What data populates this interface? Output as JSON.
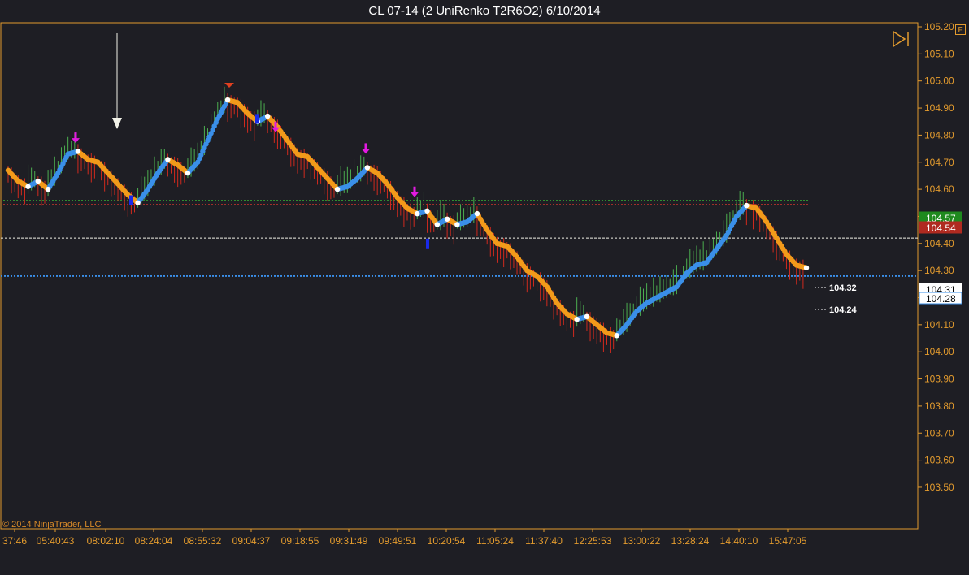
{
  "window": {
    "title": "CL 07-14 (2 UniRenko T2R6O2)  6/10/2014",
    "copyright": "© 2014 NinjaTrader, LLC",
    "corner_label": "F"
  },
  "colors": {
    "background": "#1e1e24",
    "axis": "#e39b2e",
    "text": "#e39b2e",
    "up_bar": "#4caf50",
    "down_bar": "#d12a1e",
    "trend_up": "#3a8fe8",
    "trend_down": "#f29a1a",
    "marker_pink": "#e21ae0",
    "marker_blue": "#1a2ae8"
  },
  "icons": [
    "play-to-end-icon",
    "down-arrow-icon"
  ],
  "chart_data": {
    "type": "line",
    "title": "CL 07-14 (2 UniRenko T2R6O2)  6/10/2014",
    "xlabel": "",
    "ylabel": "",
    "ylim": [
      103.42,
      105.3
    ],
    "y_ticks": [
      "105.20",
      "105.10",
      "105.00",
      "104.90",
      "104.80",
      "104.70",
      "104.60",
      "104.50",
      "104.40",
      "104.30",
      "104.20",
      "104.10",
      "104.00",
      "103.90",
      "103.80",
      "103.70",
      "103.60",
      "103.50"
    ],
    "x_ticks": [
      "37:46",
      "05:40:43",
      "08:02:10",
      "08:24:04",
      "08:55:32",
      "09:04:37",
      "09:18:55",
      "09:31:49",
      "09:49:51",
      "10:20:54",
      "11:05:24",
      "11:37:40",
      "12:25:53",
      "13:00:22",
      "13:28:24",
      "14:40:10",
      "15:47:05"
    ],
    "series": [
      {
        "name": "",
        "values": [
          104.67,
          104.63,
          104.61,
          104.63,
          104.6,
          104.66,
          104.73,
          104.74,
          104.71,
          104.7,
          104.66,
          104.62,
          104.58,
          104.55,
          104.6,
          104.66,
          104.71,
          104.69,
          104.66,
          104.7,
          104.78,
          104.86,
          104.93,
          104.92,
          104.88,
          104.85,
          104.87,
          104.83,
          104.78,
          104.73,
          104.72,
          104.68,
          104.64,
          104.6,
          104.61,
          104.64,
          104.68,
          104.66,
          104.62,
          104.57,
          104.53,
          104.51,
          104.52,
          104.47,
          104.49,
          104.47,
          104.48,
          104.51,
          104.45,
          104.4,
          104.39,
          104.35,
          104.3,
          104.28,
          104.24,
          104.18,
          104.14,
          104.12,
          104.13,
          104.1,
          104.07,
          104.06,
          104.1,
          104.15,
          104.18,
          104.2,
          104.22,
          104.24,
          104.29,
          104.32,
          104.33,
          104.38,
          104.43,
          104.5,
          104.54,
          104.53,
          104.48,
          104.42,
          104.36,
          104.32,
          104.31
        ]
      }
    ],
    "price_labels": {
      "current_high": "104.57",
      "current_low": "104.54",
      "last": "104.31",
      "blue_line": "104.28"
    },
    "level_labels": [
      "104.32",
      "104.24"
    ]
  }
}
